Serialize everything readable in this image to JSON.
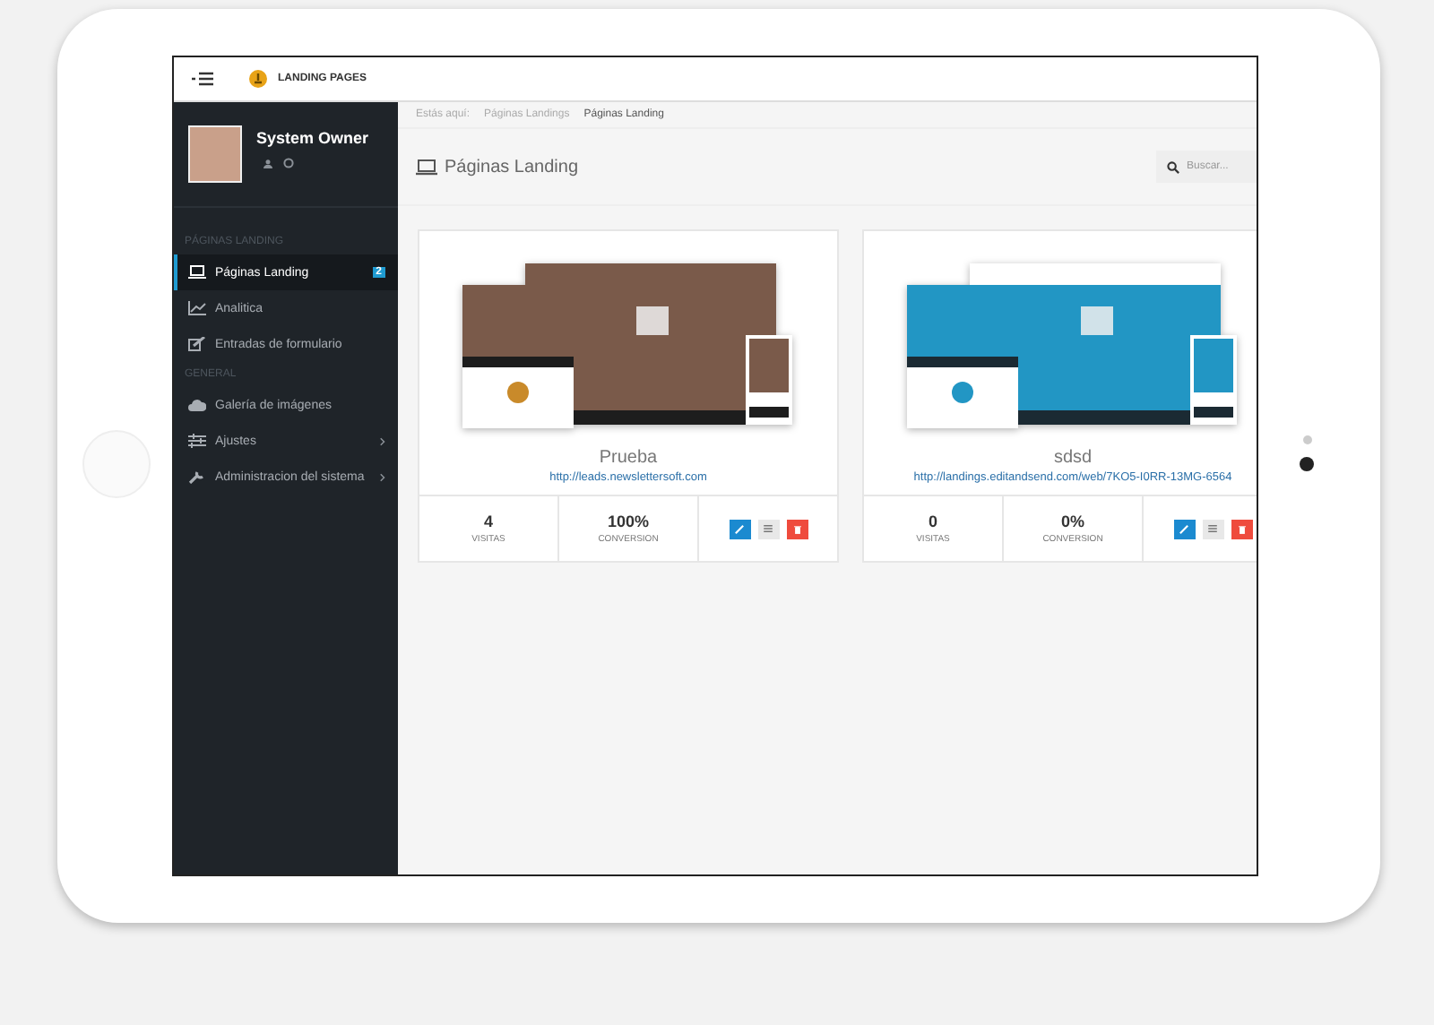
{
  "topbar": {
    "brand": "LANDING PAGES"
  },
  "sidebar": {
    "user": {
      "name": "System Owner"
    },
    "sections": [
      {
        "title": "PÁGINAS LANDING",
        "items": [
          {
            "label": "Páginas Landing",
            "kind": "laptop",
            "selected": true,
            "badge": "2",
            "submenu": false
          },
          {
            "label": "Analitica",
            "kind": "chart",
            "selected": false,
            "submenu": false
          },
          {
            "label": "Entradas de formulario",
            "kind": "edit",
            "selected": false,
            "submenu": false
          }
        ]
      },
      {
        "title": "GENERAL",
        "items": [
          {
            "label": "Galería de imágenes",
            "kind": "cloud",
            "selected": false,
            "submenu": false
          },
          {
            "label": "Ajustes",
            "kind": "sliders",
            "selected": false,
            "submenu": true
          },
          {
            "label": "Administracion del sistema",
            "kind": "wrench",
            "selected": false,
            "submenu": true
          }
        ]
      }
    ]
  },
  "breadcrumb": [
    "Estás aquí:",
    "Páginas Landings",
    "Páginas Landing"
  ],
  "page_title": "Páginas Landing",
  "search": {
    "placeholder": "Buscar..."
  },
  "cards": [
    {
      "kind": "brick",
      "name": "Prueba",
      "url": "http://leads.newslettersoft.com",
      "stats": [
        {
          "value": "4",
          "label": "VISITAS"
        },
        {
          "value": "100%",
          "label": "CONVERSION"
        }
      ]
    },
    {
      "kind": "blue",
      "name": "sdsd",
      "url": "http://landings.editandsend.com/web/7KO5-I0RR-13MG-6564",
      "stats": [
        {
          "value": "0",
          "label": "VISITAS"
        },
        {
          "value": "0%",
          "label": "CONVERSION"
        }
      ]
    }
  ]
}
